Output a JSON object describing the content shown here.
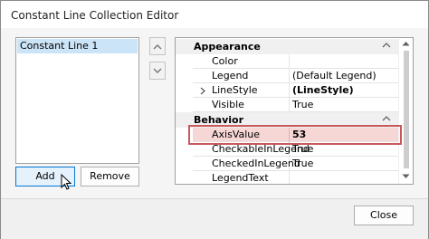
{
  "window": {
    "title": "Constant Line Collection Editor"
  },
  "list": {
    "items": [
      {
        "label": "Constant Line 1",
        "selected": true
      }
    ]
  },
  "buttons": {
    "add": "Add",
    "remove": "Remove",
    "close": "Close",
    "move_up_icon": "chevron-up-icon",
    "move_down_icon": "chevron-down-icon"
  },
  "property_grid": {
    "categories": [
      {
        "name": "Appearance",
        "rows": [
          {
            "name": "Color",
            "value": ""
          },
          {
            "name": "Legend",
            "value": "(Default Legend)"
          },
          {
            "name": "LineStyle",
            "value": "(LineStyle)",
            "expandable": true,
            "bold": true
          },
          {
            "name": "Visible",
            "value": "True"
          }
        ]
      },
      {
        "name": "Behavior",
        "rows": [
          {
            "name": "AxisValue",
            "value": "53",
            "bold": true,
            "selected": true
          },
          {
            "name": "CheckableInLegend",
            "value": "True"
          },
          {
            "name": "CheckedInLegend",
            "value": "True"
          },
          {
            "name": "LegendText",
            "value": ""
          }
        ]
      }
    ]
  },
  "colors": {
    "accent": "#0078d7",
    "selection": "#cce4f7",
    "highlight": "#c9595c"
  }
}
